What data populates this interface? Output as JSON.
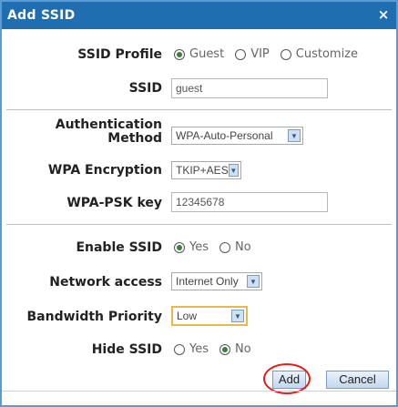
{
  "dialog": {
    "title": "Add SSID",
    "close_glyph": "×"
  },
  "form": {
    "ssid_profile": {
      "label": "SSID Profile",
      "options": [
        {
          "label": "Guest",
          "selected": true
        },
        {
          "label": "VIP",
          "selected": false
        },
        {
          "label": "Customize",
          "selected": false
        }
      ]
    },
    "ssid": {
      "label": "SSID",
      "value": "guest"
    },
    "auth_method": {
      "label": "Authentication Method",
      "value": "WPA-Auto-Personal"
    },
    "wpa_encryption": {
      "label": "WPA Encryption",
      "value": "TKIP+AES"
    },
    "wpa_psk_key": {
      "label": "WPA-PSK key",
      "value": "12345678"
    },
    "enable_ssid": {
      "label": "Enable SSID",
      "options": [
        {
          "label": "Yes",
          "selected": true
        },
        {
          "label": "No",
          "selected": false
        }
      ]
    },
    "network_access": {
      "label": "Network access",
      "value": "Internet Only"
    },
    "bandwidth_priority": {
      "label": "Bandwidth Priority",
      "value": "Low"
    },
    "hide_ssid": {
      "label": "Hide SSID",
      "options": [
        {
          "label": "Yes",
          "selected": false
        },
        {
          "label": "No",
          "selected": true
        }
      ]
    }
  },
  "buttons": {
    "add": "Add",
    "cancel": "Cancel"
  },
  "icons": {
    "close": "close-icon",
    "dropdown": "chevron-down-icon"
  },
  "colors": {
    "titlebar": "#1f6fb0",
    "highlight_ring": "#e31b1b"
  }
}
